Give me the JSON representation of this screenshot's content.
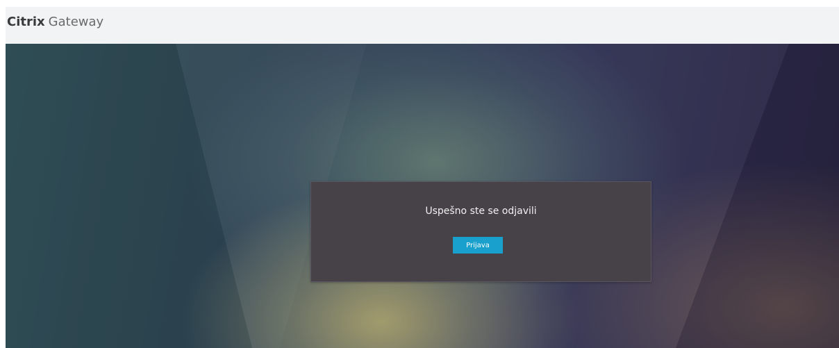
{
  "header": {
    "brand_bold": "Citrix",
    "brand_light": "Gateway"
  },
  "dialog": {
    "message": "Uspešno ste se odjavili",
    "login_label": "Prijava"
  },
  "colors": {
    "accent": "#1aa0cc",
    "dialog_bg": "#474148",
    "header_bg": "#f2f3f5"
  }
}
